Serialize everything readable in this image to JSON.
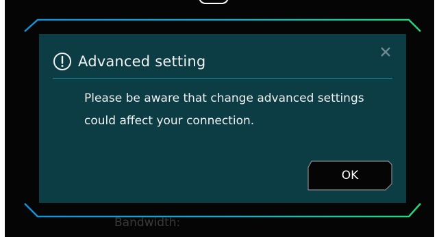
{
  "dialog": {
    "title": "Advanced setting",
    "message": "Please be aware that change advanced settings could affect your connection.",
    "ok_label": "OK",
    "close_icon": "close-icon",
    "warning_icon": "exclamation-circle-icon"
  },
  "background": {
    "field_label": "Bandwidth:"
  },
  "colors": {
    "dialog_bg": "#0c3c44",
    "divider": "#1f8fa5",
    "frame_blue": "#1a8fd6",
    "frame_green": "#2cd67a",
    "button_bg": "#050505",
    "text": "#f0f0f0"
  }
}
